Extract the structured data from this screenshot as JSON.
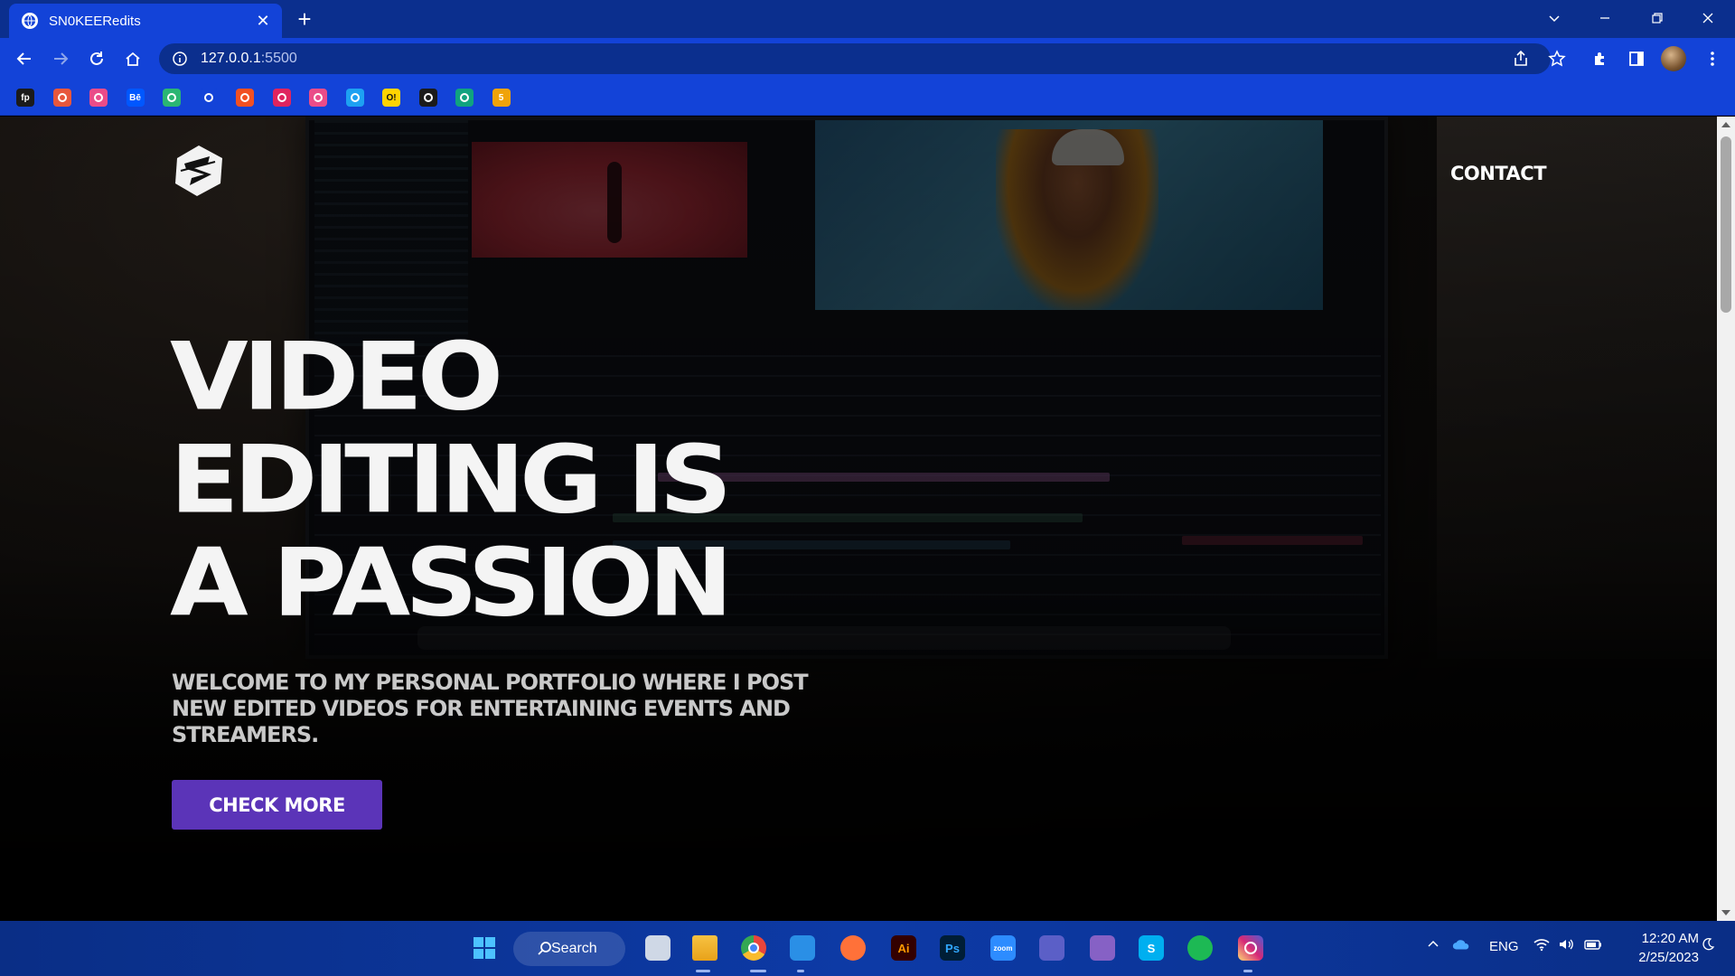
{
  "browser": {
    "tab_title": "SN0KEERedits",
    "tab_close": "✕",
    "new_tab": "+",
    "url_host": "127.0.0.1",
    "url_port": ":5500",
    "bookmarks": [
      {
        "icon": "fp-icon",
        "label": "fp",
        "color": "#1b1b1b"
      },
      {
        "icon": "codewars-icon",
        "label": "",
        "color": "#e8573c"
      },
      {
        "icon": "dribbble-icon",
        "label": "",
        "color": "#ea4c89"
      },
      {
        "icon": "behance-icon",
        "label": "Bē",
        "color": "#0057ff"
      },
      {
        "icon": "green-app-icon",
        "label": "",
        "color": "#2bb673"
      },
      {
        "icon": "github-icon",
        "label": "",
        "color": "#1343d8"
      },
      {
        "icon": "microsoft-icon",
        "label": "",
        "color": "#f25022"
      },
      {
        "icon": "target-icon",
        "label": "",
        "color": "#e0245e"
      },
      {
        "icon": "dribbble-icon",
        "label": "",
        "color": "#ea4c89"
      },
      {
        "icon": "search-app-icon",
        "label": "",
        "color": "#1da1f2"
      },
      {
        "icon": "ol-icon",
        "label": "O!",
        "color": "#ffd400"
      },
      {
        "icon": "chat-icon",
        "label": "",
        "color": "#1b1b1b"
      },
      {
        "icon": "copilot-icon",
        "label": "",
        "color": "#10a37f"
      },
      {
        "icon": "five-icon",
        "label": "5",
        "color": "#f0a30a"
      }
    ]
  },
  "page": {
    "nav_contact": "CONTACT",
    "hero_lines": [
      "VIDEO",
      "EDITING IS",
      "A PASSION"
    ],
    "subtitle": "WELCOME TO MY PERSONAL PORTFOLIO WHERE I POST NEW EDITED VIDEOS FOR ENTERTAINING EVENTS AND STREAMERS.",
    "cta_label": "CHECK MORE",
    "accent": "#5b34b8"
  },
  "taskbar": {
    "search_label": "Search",
    "apps": [
      {
        "icon": "windows-start-icon",
        "color": "#4cc2ff"
      },
      {
        "icon": "task-view-icon",
        "color": "#cfd8e6"
      },
      {
        "icon": "file-explorer-icon",
        "color": "#f7c242"
      },
      {
        "icon": "chrome-icon",
        "color": "#e8453c"
      },
      {
        "icon": "vscode-icon",
        "color": "#2a8fe6"
      },
      {
        "icon": "firefox-icon",
        "color": "#ff7139"
      },
      {
        "icon": "illustrator-icon",
        "label": "Ai",
        "color": "#330000",
        "fg": "#ff9a00"
      },
      {
        "icon": "photoshop-icon",
        "label": "Ps",
        "color": "#001e36",
        "fg": "#31a8ff"
      },
      {
        "icon": "zoom-icon",
        "label": "zoom",
        "color": "#2d8cff",
        "fg": "#ffffff"
      },
      {
        "icon": "teams-icon",
        "color": "#5b5fc7"
      },
      {
        "icon": "visual-studio-icon",
        "color": "#8661c5"
      },
      {
        "icon": "skype-icon",
        "label": "S",
        "color": "#00aff0",
        "fg": "#ffffff"
      },
      {
        "icon": "spotify-icon",
        "color": "#1db954"
      },
      {
        "icon": "instagram-icon",
        "color": "#d62976"
      }
    ],
    "language": "ENG",
    "time": "12:20 AM",
    "date": "2/25/2023"
  }
}
